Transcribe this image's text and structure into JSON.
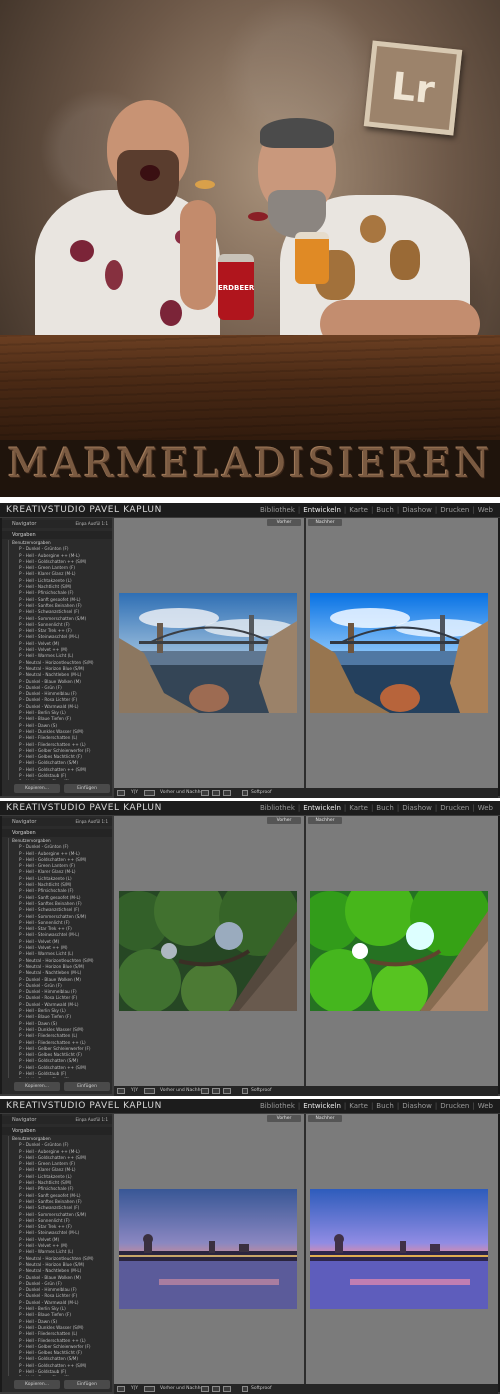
{
  "hero": {
    "title": "MARMELADISIEREN",
    "logo_text": "Lr",
    "jar_left_label": "ERDBEER",
    "colors": {
      "wall": "#6d5848",
      "table": "#4b2a15",
      "title": "#7a5a41"
    }
  },
  "lightroom": {
    "brand": "KREATIVSTUDIO PAVEL KAPLUN",
    "modules": [
      "Bibliothek",
      "Entwickeln",
      "Karte",
      "Buch",
      "Diashow",
      "Drucken",
      "Web"
    ],
    "active_module": "Entwickeln",
    "navigator_label": "Navigator",
    "navigator_tabs": "Einpa  Ausfül  1:1",
    "presets_label": "Vorgaben",
    "group_label": "Benutzervorgaben",
    "presets": [
      "P - Dunkel - Grünton (F)",
      "P - Hell - Aubergine ++ (M-L)",
      "P - Hell - Goldschatten ++ (S/M)",
      "P - Hell - Green Lantern (F)",
      "P - Hell - Klarer Glanz (M-L)",
      "P - Hell - Lichtakzente (L)",
      "P - Hell - Nachtlicht (S/M)",
      "P - Hell - Pfirsichschale (F)",
      "P - Hell - Sanft gesoofet (M-L)",
      "P - Hell - Sanftes Beinahen (F)",
      "P - Hell - Schwanzstichsel (F)",
      "P - Hell - Sommerschatten (S/M)",
      "P - Hell - Sonnenlicht (F)",
      "P - Hell - Star Trek ++ (F)",
      "P - Hell - Steinwaschtel (M-L)",
      "P - Hell - Velvet (M)",
      "P - Hell - Velvet ++ (M)",
      "P - Hell - Warmes Licht (L)",
      "P - Neutral - Horizontleuchten (S/M)",
      "P - Neutral - Horizon Blue (S/M)",
      "P - Neutral - Nachtleben (M-L)",
      "P - Dunkel - Blaue Wolken (M)",
      "P - Dunkel - Grün (F)",
      "P - Dunkel - Himmelblau (F)",
      "P - Dunkel - Rosa Lichter (F)",
      "P - Dunkel - Warmwald (M-L)",
      "P - Hell - Berlin Sky (L)",
      "P - Hell - Blaue Tiefen (F)",
      "P - Hell - Dawn (S)",
      "P - Hell - Dunkles Wasser (S/M)",
      "P - Hell - Fliederschatten (L)",
      "P - Hell - Fliederschatten ++ (L)",
      "P - Hell - Gelber Schleierwerfer (F)",
      "P - Hell - Gelbes Nachtlicht (F)",
      "P - Hell - Goldschatten (S/M)",
      "P - Hell - Goldschatten ++ (S/M)",
      "P - Hell - Goldstaub (F)",
      "P - Hell - Green Glow (F)",
      "P - Hell - Mondstein (F)",
      "P - Hell - Morning City (S)"
    ],
    "buttons": {
      "import": "Kopieren...",
      "export": "Einfügen"
    },
    "before_label": "Vorher",
    "after_label": "Nachher",
    "toolbar": {
      "view_mode": "Vorher und Nachher:",
      "softproof": "Softproof",
      "view_code": "Y|Y"
    }
  }
}
